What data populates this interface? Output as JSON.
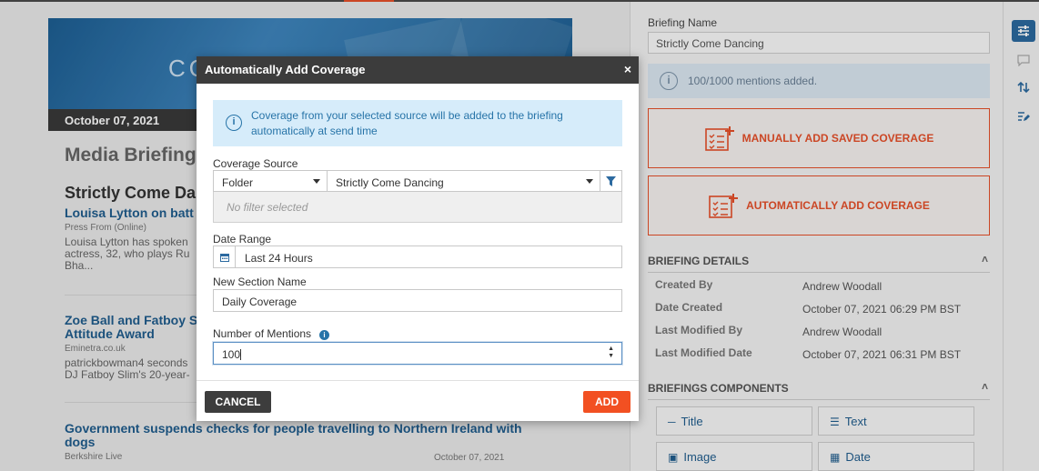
{
  "hero": {
    "banner_text": "CO"
  },
  "briefing": {
    "date": "October 07, 2021",
    "title": "Media Briefing",
    "section": "Strictly Come Da",
    "articles": [
      {
        "headline": "Louisa Lytton on batt",
        "source": "Press From (Online)",
        "snippet": "Louisa Lytton has spoken\nactress, 32, who plays Ru\nBha..."
      },
      {
        "headline": "Zoe Ball and Fatboy S\nAttitude Award",
        "source": "Eminetra.co.uk",
        "snippet": "patrickbowman4 seconds\nDJ Fatboy Slim's 20-year-"
      },
      {
        "headline": "Government suspends checks for people travelling to Northern Ireland with\ndogs",
        "source": "Berkshire Live",
        "date": "October 07, 2021"
      }
    ]
  },
  "right": {
    "briefing_name_label": "Briefing Name",
    "briefing_name_value": "Strictly Come Dancing",
    "mentions_info": "100/1000 mentions added.",
    "manual_btn": "MANUALLY ADD SAVED COVERAGE",
    "auto_btn": "AUTOMATICALLY ADD COVERAGE",
    "details_heading": "BRIEFING DETAILS",
    "details": [
      {
        "key": "Created By",
        "value": "Andrew Woodall"
      },
      {
        "key": "Date Created",
        "value": "October 07, 2021 06:29 PM BST"
      },
      {
        "key": "Last Modified By",
        "value": "Andrew Woodall"
      },
      {
        "key": "Last Modified Date",
        "value": "October 07, 2021 06:31 PM BST"
      }
    ],
    "components_heading": "BRIEFINGS COMPONENTS",
    "components": [
      "Title",
      "Text",
      "Image",
      "Date"
    ]
  },
  "modal": {
    "title": "Automatically Add Coverage",
    "close": "×",
    "notice": "Coverage from your selected source will be added to the briefing automatically at send time",
    "coverage_source_label": "Coverage Source",
    "source_type": "Folder",
    "source_value": "Strictly Come Dancing",
    "no_filter": "No filter selected",
    "date_range_label": "Date Range",
    "date_range_value": "Last 24 Hours",
    "section_name_label": "New Section Name",
    "section_name_value": "Daily Coverage",
    "mentions_label": "Number of Mentions",
    "mentions_value": "100",
    "cancel": "CANCEL",
    "add": "ADD"
  },
  "colors": {
    "accent": "#f25022",
    "link": "#1f5d8e",
    "info_bg": "#d6ecfa",
    "dark": "#3c3c3c"
  }
}
